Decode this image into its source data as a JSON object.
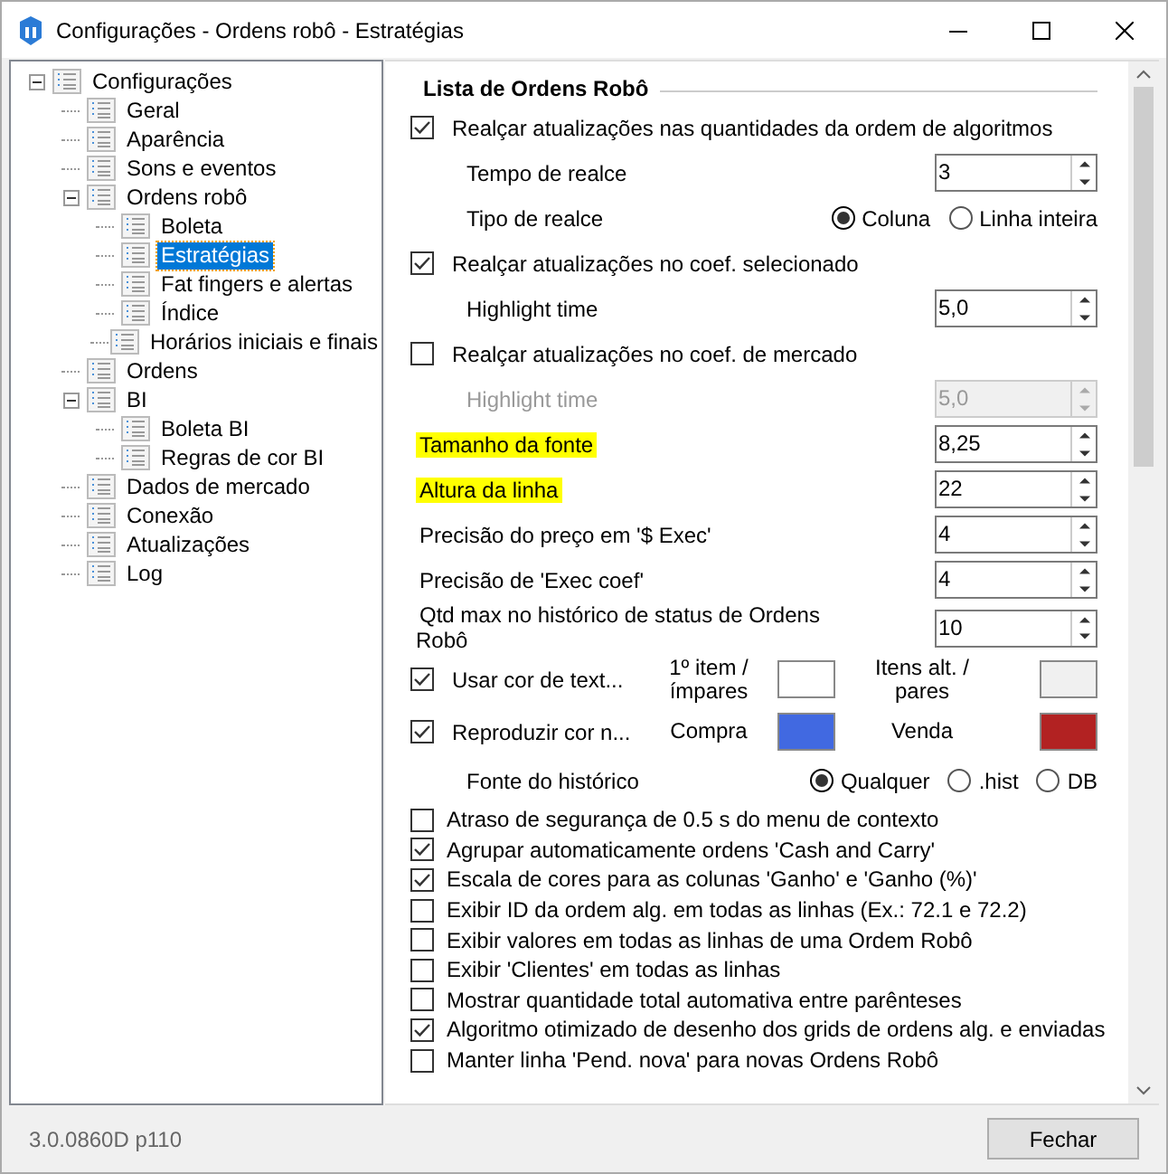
{
  "window": {
    "title": "Configurações - Ordens robô - Estratégias"
  },
  "tree": [
    {
      "label": "Configurações",
      "expanded": true,
      "selected": false,
      "children": [
        {
          "label": "Geral",
          "selected": false
        },
        {
          "label": "Aparência",
          "selected": false
        },
        {
          "label": "Sons e eventos",
          "selected": false
        },
        {
          "label": "Ordens robô",
          "expanded": true,
          "selected": false,
          "children": [
            {
              "label": "Boleta",
              "selected": false
            },
            {
              "label": "Estratégias",
              "selected": true
            },
            {
              "label": "Fat fingers e alertas",
              "selected": false
            },
            {
              "label": "Índice",
              "selected": false
            },
            {
              "label": "Horários iniciais e finais",
              "selected": false
            }
          ]
        },
        {
          "label": "Ordens",
          "selected": false
        },
        {
          "label": "BI",
          "expanded": true,
          "selected": false,
          "children": [
            {
              "label": "Boleta BI",
              "selected": false
            },
            {
              "label": "Regras de cor BI",
              "selected": false
            }
          ]
        },
        {
          "label": "Dados de mercado",
          "selected": false
        },
        {
          "label": "Conexão",
          "selected": false
        },
        {
          "label": "Atualizações",
          "selected": false
        },
        {
          "label": "Log",
          "selected": false
        }
      ]
    }
  ],
  "section": {
    "title": "Lista de Ordens Robô"
  },
  "settings": [
    {
      "kind": "checkbox",
      "label": "Realçar atualizações nas quantidades da ordem de algoritmos",
      "checked": true
    },
    {
      "kind": "spin",
      "label": "Tempo de realce",
      "value": "3",
      "indented": true,
      "disabled": false,
      "highlighted": false
    },
    {
      "kind": "radio",
      "label": "Tipo de realce",
      "indented": true,
      "options": [
        {
          "label": "Coluna",
          "selected": true
        },
        {
          "label": "Linha inteira",
          "selected": false
        }
      ]
    },
    {
      "kind": "checkbox",
      "label": "Realçar atualizações no coef. selecionado",
      "checked": true
    },
    {
      "kind": "spin",
      "label": "Highlight time",
      "value": "5,0",
      "indented": true,
      "disabled": false,
      "highlighted": false
    },
    {
      "kind": "checkbox",
      "label": "Realçar atualizações no coef. de mercado",
      "checked": false
    },
    {
      "kind": "spin",
      "label": "Highlight time",
      "value": "5,0",
      "indented": true,
      "disabled": true,
      "highlighted": false
    },
    {
      "kind": "spin",
      "label": "Tamanho da fonte",
      "value": "8,25",
      "indented": false,
      "disabled": false,
      "highlighted": true
    },
    {
      "kind": "spin",
      "label": "Altura da linha",
      "value": "22",
      "indented": false,
      "disabled": false,
      "highlighted": true
    },
    {
      "kind": "spin",
      "label": "Precisão do preço em '$ Exec'",
      "value": "4",
      "indented": false,
      "disabled": false,
      "highlighted": false
    },
    {
      "kind": "spin",
      "label": "Precisão de 'Exec coef'",
      "value": "4",
      "indented": false,
      "disabled": false,
      "highlighted": false
    },
    {
      "kind": "spin",
      "label": "Qtd max no histórico de status de Ordens Robô",
      "value": "10",
      "indented": false,
      "disabled": false,
      "highlighted": false
    },
    {
      "kind": "colors",
      "label": "Usar cor de text...",
      "checked": true,
      "swatches": [
        {
          "label": "1º item / ímpares",
          "color": "#ffffff"
        },
        {
          "label": "Itens alt. / pares",
          "color": "#f0f0f0"
        }
      ]
    },
    {
      "kind": "colors",
      "label": "Reproduzir cor n...",
      "checked": true,
      "swatches": [
        {
          "label": "Compra",
          "color": "#4169e1"
        },
        {
          "label": "Venda",
          "color": "#b22222"
        }
      ]
    },
    {
      "kind": "radio",
      "label": "Fonte do histórico",
      "indented": true,
      "options": [
        {
          "label": "Qualquer",
          "selected": true
        },
        {
          "label": ".hist",
          "selected": false
        },
        {
          "label": "DB",
          "selected": false
        }
      ]
    }
  ],
  "options": [
    {
      "label": "Atraso de segurança de 0.5 s do menu de contexto",
      "checked": false
    },
    {
      "label": "Agrupar automaticamente ordens 'Cash and Carry'",
      "checked": true
    },
    {
      "label": "Escala de cores para as colunas 'Ganho' e 'Ganho (%)'",
      "checked": true
    },
    {
      "label": "Exibir ID da ordem alg. em todas as linhas (Ex.: 72.1 e 72.2)",
      "checked": false
    },
    {
      "label": "Exibir valores em todas as linhas de uma Ordem Robô",
      "checked": false
    },
    {
      "label": "Exibir 'Clientes' em todas as linhas",
      "checked": false
    },
    {
      "label": "Mostrar quantidade total automativa entre parênteses",
      "checked": false
    },
    {
      "label": "Algoritmo otimizado de desenho dos grids de ordens alg. e enviadas",
      "checked": true
    },
    {
      "label": "Manter linha 'Pend. nova' para novas Ordens Robô",
      "checked": false
    }
  ],
  "status": {
    "version": "3.0.0860D p110"
  },
  "buttons": [
    "Fechar"
  ]
}
